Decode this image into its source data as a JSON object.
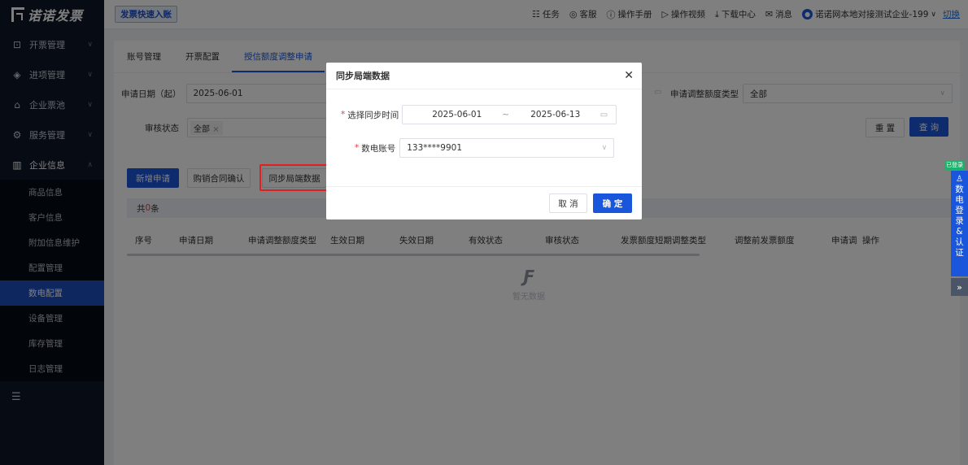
{
  "app": {
    "logo_text": "诺诺发票"
  },
  "sidebar": {
    "items": [
      {
        "label": "开票管理",
        "icon": "invoice-icon"
      },
      {
        "label": "进项管理",
        "icon": "layers-icon"
      },
      {
        "label": "企业票池",
        "icon": "wallet-icon"
      },
      {
        "label": "服务管理",
        "icon": "service-icon"
      },
      {
        "label": "企业信息",
        "icon": "building-icon"
      }
    ],
    "sub_items": [
      "商品信息",
      "客户信息",
      "附加信息维护",
      "配置管理",
      "数电配置",
      "设备管理",
      "库存管理",
      "日志管理"
    ],
    "active_sub": "数电配置"
  },
  "topbar": {
    "quick_tag": "发票快速入账",
    "links": [
      {
        "label": "任务",
        "icon": "task-icon"
      },
      {
        "label": "客服",
        "icon": "headset-icon"
      },
      {
        "label": "操作手册",
        "icon": "help-icon"
      },
      {
        "label": "操作视频",
        "icon": "video-icon"
      },
      {
        "label": "下载中心",
        "icon": "download-icon"
      },
      {
        "label": "消息",
        "icon": "mail-icon"
      }
    ],
    "company": "诺诺网本地对接测试企业-199",
    "switch_label": "切换"
  },
  "tabs": [
    "账号管理",
    "开票配置",
    "授信额度调整申请"
  ],
  "filters": {
    "date_label": "申请日期（起）",
    "date_value": "2025-06-01",
    "quota_type_label": "申请调整额度类型",
    "quota_type_value": "全部",
    "status_label": "审核状态",
    "status_chip": "全部",
    "reset_label": "重 置",
    "query_label": "查 询"
  },
  "actions": {
    "add": "新增申请",
    "confirm": "购销合同确认",
    "sync": "同步局端数据"
  },
  "table": {
    "count_prefix": "共",
    "count": "0",
    "count_suffix": "条",
    "headers": [
      "序号",
      "申请日期",
      "申请调整额度类型",
      "生效日期",
      "失效日期",
      "有效状态",
      "审核状态",
      "发票额度短期调整类型",
      "调整前发票额度",
      "申请调",
      "操作"
    ],
    "empty_text": "暂无数据"
  },
  "modal": {
    "title": "同步局端数据",
    "time_label": "选择同步时间",
    "start_date": "2025-06-01",
    "range_sep": "~",
    "end_date": "2025-06-13",
    "account_label": "数电账号",
    "account_value": "133****9901",
    "cancel_label": "取 消",
    "ok_label": "确 定"
  },
  "side_float": {
    "badge": "已登录",
    "text": "数电登录&认证",
    "expand": "»"
  }
}
